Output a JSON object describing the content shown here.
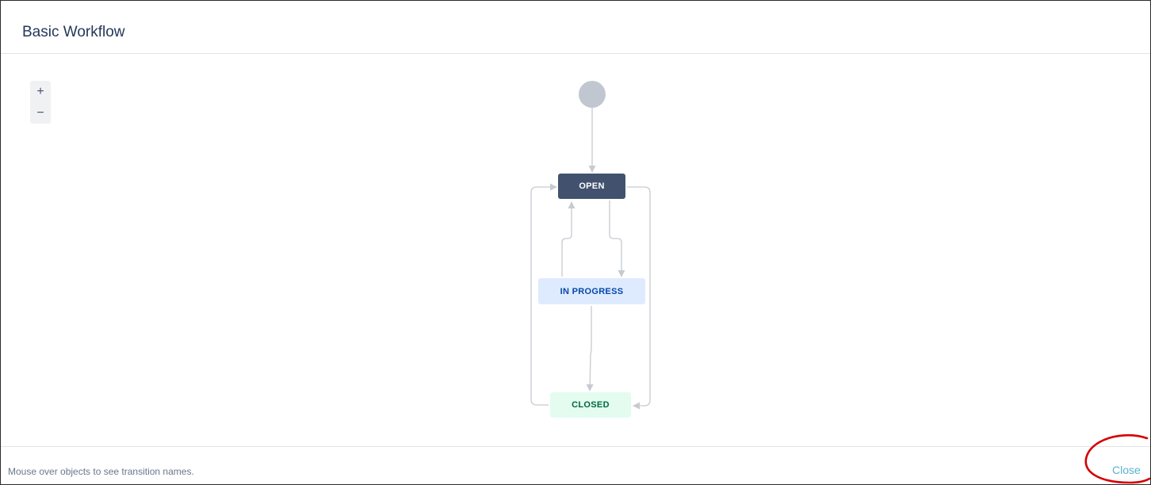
{
  "dialog": {
    "title": "Basic Workflow",
    "footer_hint": "Mouse over objects to see transition names.",
    "close_label": "Close"
  },
  "zoom": {
    "in_label": "+",
    "out_label": "−"
  },
  "workflow": {
    "statuses": [
      {
        "label": "OPEN",
        "category": "to-do",
        "color": "#42526e"
      },
      {
        "label": "IN PROGRESS",
        "category": "in-progress",
        "color": "#deebff"
      },
      {
        "label": "CLOSED",
        "category": "done",
        "color": "#e3fcef"
      }
    ]
  },
  "annotation": {
    "highlight_color": "#d40000",
    "target": "close-link"
  }
}
